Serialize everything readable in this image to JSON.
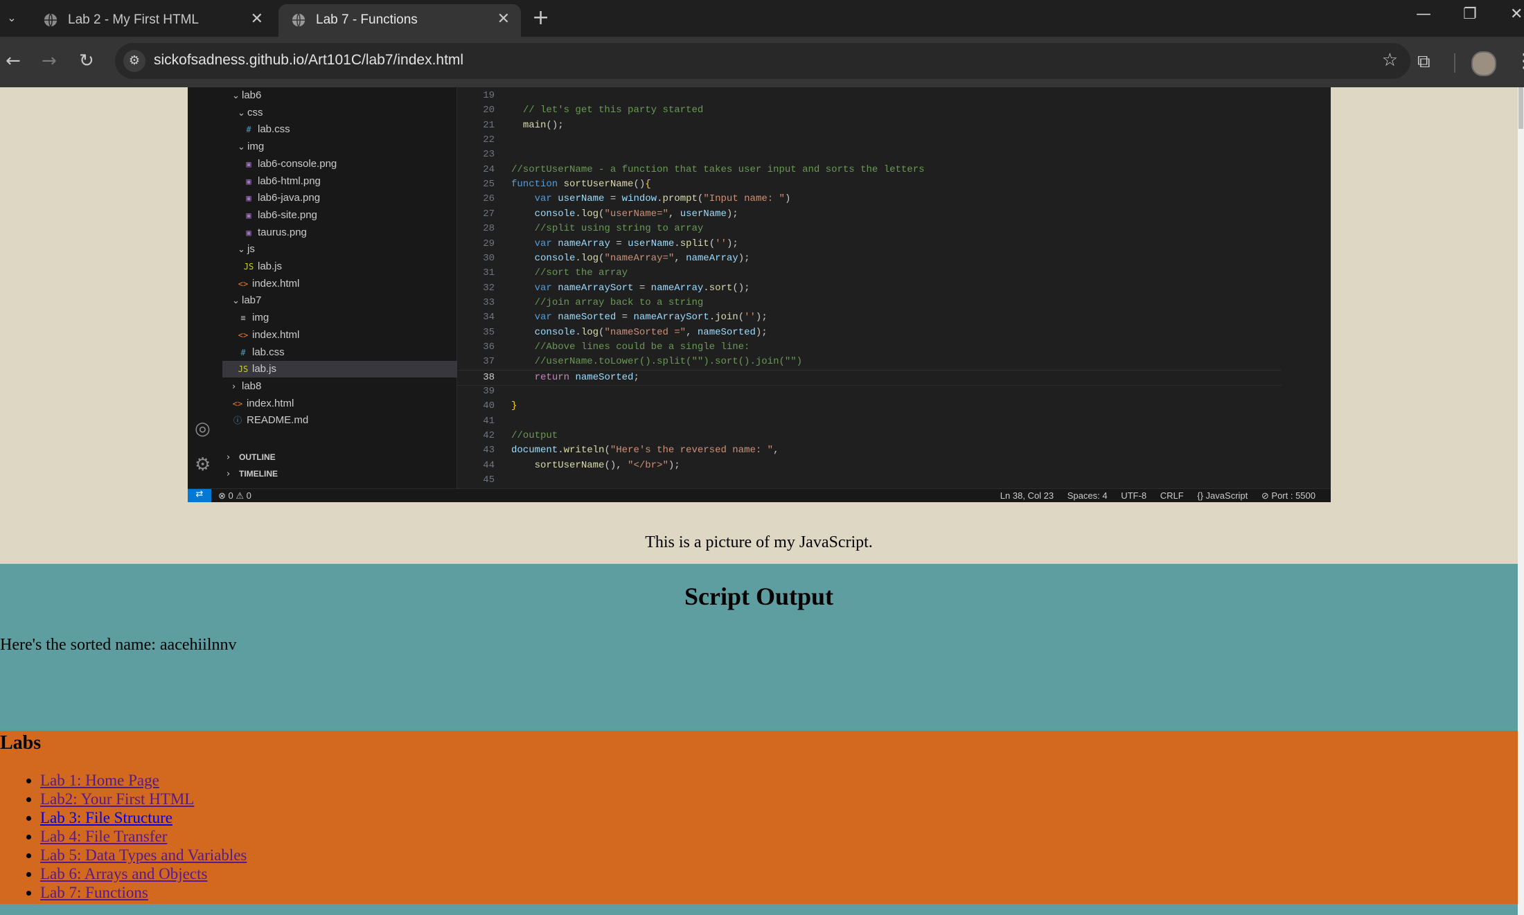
{
  "browser": {
    "tabs": [
      {
        "title": "Lab 2 - My First HTML",
        "active": false
      },
      {
        "title": "Lab 7 - Functions",
        "active": true
      }
    ],
    "url": "sickofsadness.github.io/Art101C/lab7/index.html"
  },
  "vscode": {
    "tree": [
      {
        "label": "lab6",
        "kind": "folder-open"
      },
      {
        "label": "css",
        "kind": "folder-open"
      },
      {
        "label": "lab.css",
        "kind": "css"
      },
      {
        "label": "img",
        "kind": "folder-open"
      },
      {
        "label": "lab6-console.png",
        "kind": "image"
      },
      {
        "label": "lab6-html.png",
        "kind": "image"
      },
      {
        "label": "lab6-java.png",
        "kind": "image"
      },
      {
        "label": "lab6-site.png",
        "kind": "image"
      },
      {
        "label": "taurus.png",
        "kind": "image"
      },
      {
        "label": "js",
        "kind": "folder-open"
      },
      {
        "label": "lab.js",
        "kind": "js"
      },
      {
        "label": "index.html",
        "kind": "html"
      },
      {
        "label": "lab7",
        "kind": "folder-open"
      },
      {
        "label": "img",
        "kind": "folder-lines"
      },
      {
        "label": "index.html",
        "kind": "html"
      },
      {
        "label": "lab.css",
        "kind": "css"
      },
      {
        "label": "lab.js",
        "kind": "js",
        "selected": true
      },
      {
        "label": "lab8",
        "kind": "folder-closed"
      },
      {
        "label": "index.html",
        "kind": "html"
      },
      {
        "label": "README.md",
        "kind": "md"
      }
    ],
    "panels": {
      "outline": "OUTLINE",
      "timeline": "TIMELINE"
    },
    "code": [
      {
        "n": "19",
        "text": ""
      },
      {
        "n": "20",
        "text": "  // let's get this party started"
      },
      {
        "n": "21",
        "text": "  main();"
      },
      {
        "n": "22",
        "text": ""
      },
      {
        "n": "23",
        "text": ""
      },
      {
        "n": "24",
        "text": "//sortUserName - a function that takes user input and sorts the letters"
      },
      {
        "n": "25",
        "text": "function sortUserName(){"
      },
      {
        "n": "26",
        "text": "    var userName = window.prompt(\"Input name: \")"
      },
      {
        "n": "27",
        "text": "    console.log(\"userName=\", userName);"
      },
      {
        "n": "28",
        "text": "    //split using string to array"
      },
      {
        "n": "29",
        "text": "    var nameArray = userName.split('');"
      },
      {
        "n": "30",
        "text": "    console.log(\"nameArray=\", nameArray);"
      },
      {
        "n": "31",
        "text": "    //sort the array"
      },
      {
        "n": "32",
        "text": "    var nameArraySort = nameArray.sort();"
      },
      {
        "n": "33",
        "text": "    //join array back to a string"
      },
      {
        "n": "34",
        "text": "    var nameSorted = nameArraySort.join('');"
      },
      {
        "n": "35",
        "text": "    console.log(\"nameSorted =\", nameSorted);"
      },
      {
        "n": "36",
        "text": "    //Above lines could be a single line:"
      },
      {
        "n": "37",
        "text": "    //userName.toLower().split(\"\").sort().join(\"\")"
      },
      {
        "n": "38",
        "text": "    return nameSorted;"
      },
      {
        "n": "39",
        "text": ""
      },
      {
        "n": "40",
        "text": "}"
      },
      {
        "n": "41",
        "text": ""
      },
      {
        "n": "42",
        "text": "//output"
      },
      {
        "n": "43",
        "text": "document.writeln(\"Here's the reversed name: \","
      },
      {
        "n": "44",
        "text": "    sortUserName(), \"</br>\");"
      },
      {
        "n": "45",
        "text": ""
      }
    ],
    "current_line": "38",
    "status": {
      "problems": "⊗ 0 ⚠ 0",
      "position": "Ln 38, Col 23",
      "spaces": "Spaces: 4",
      "encoding": "UTF-8",
      "eol": "CRLF",
      "language": "{} JavaScript",
      "port": "⊘ Port : 5500"
    }
  },
  "caption": "This is a picture of my JavaScript.",
  "output": {
    "heading": "Script Output",
    "text": "Here's the sorted name: aacehiilnnv"
  },
  "labs": {
    "heading": "Labs",
    "links": [
      {
        "label": "Lab 1: Home Page",
        "visited": true
      },
      {
        "label": "Lab2: Your First HTML",
        "visited": true
      },
      {
        "label": "Lab 3: File Structure",
        "visited": false
      },
      {
        "label": "Lab 4: File Transfer",
        "visited": true
      },
      {
        "label": "Lab 5: Data Types and Variables",
        "visited": true
      },
      {
        "label": "Lab 6: Arrays and Objects",
        "visited": true
      },
      {
        "label": "Lab 7: Functions",
        "visited": true
      }
    ]
  },
  "colors": {
    "picture_bg": "#ddd7c4",
    "output_bg": "#5f9ea0",
    "labs_bg": "#d2691e",
    "visited_link": "#551a8b",
    "link": "#0000ee"
  }
}
